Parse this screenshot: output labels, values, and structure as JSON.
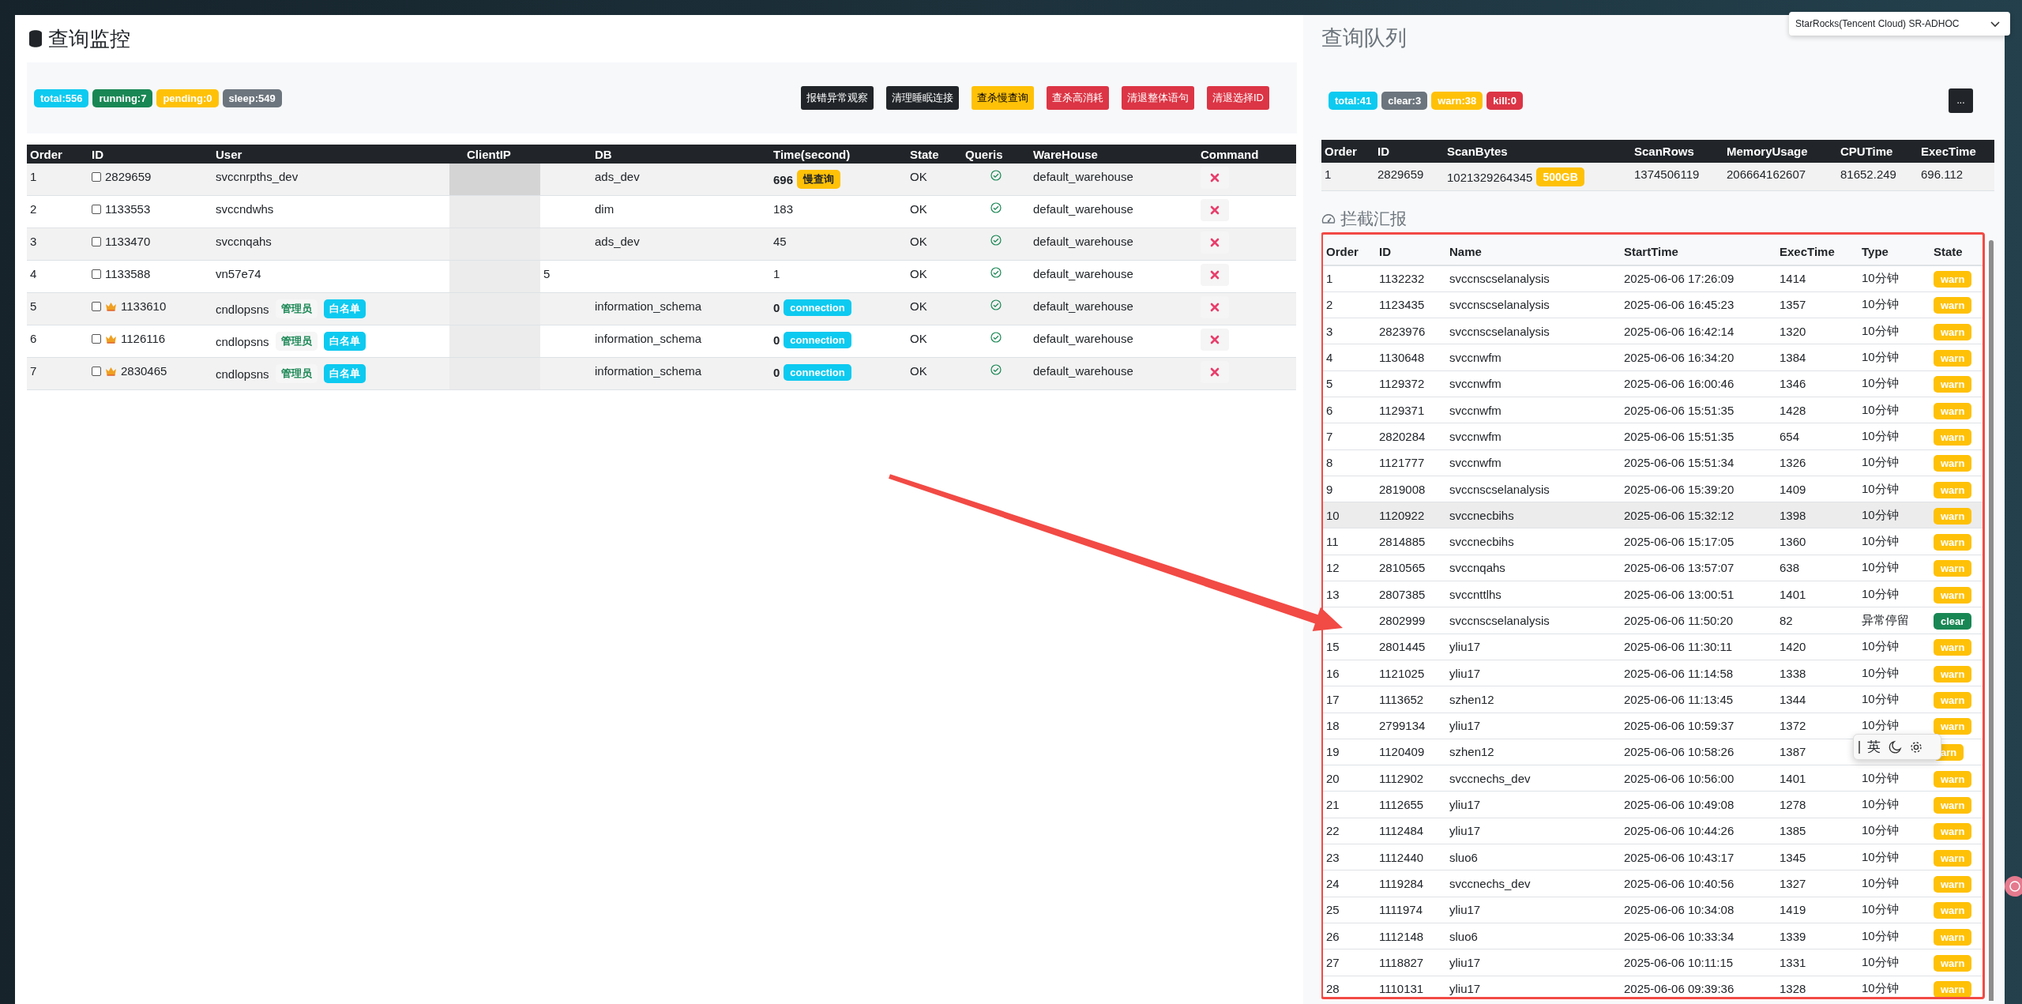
{
  "monitor": {
    "title": "查询监控",
    "badges": [
      {
        "label": "total:556",
        "kind": "info"
      },
      {
        "label": "running:7",
        "kind": "success"
      },
      {
        "label": "pending:0",
        "kind": "warning"
      },
      {
        "label": "sleep:549",
        "kind": "secondary"
      }
    ],
    "buttons": [
      {
        "label": "报错异常观察",
        "kind": "dark"
      },
      {
        "label": "清理睡眠连接",
        "kind": "dark"
      },
      {
        "label": "查杀慢查询",
        "kind": "warning"
      },
      {
        "label": "查杀高消耗",
        "kind": "danger"
      },
      {
        "label": "清退整体语句",
        "kind": "danger"
      },
      {
        "label": "清退选择ID",
        "kind": "danger"
      }
    ],
    "table": {
      "columns": [
        "Order",
        "ID",
        "User",
        "ClientIP",
        "DB",
        "Time(second)",
        "State",
        "Queris",
        "WareHouse",
        "Command"
      ],
      "rows": [
        {
          "order": "1",
          "checked": false,
          "crown": false,
          "id": "2829659",
          "user": "svccnrpths_dev",
          "roles": [],
          "db": "ads_dev",
          "time": "696",
          "time_bold": true,
          "time_tag": {
            "label": "慢查询",
            "kind": "warning"
          },
          "state": "OK",
          "warehouse": "default_warehouse"
        },
        {
          "order": "2",
          "checked": false,
          "crown": false,
          "id": "1133553",
          "user": "svccndwhs",
          "roles": [],
          "db": "dim",
          "time": "183",
          "time_bold": false,
          "state": "OK",
          "warehouse": "default_warehouse"
        },
        {
          "order": "3",
          "checked": false,
          "crown": false,
          "id": "1133470",
          "user": "svccnqahs",
          "roles": [],
          "db": "ads_dev",
          "time": "45",
          "time_bold": false,
          "state": "OK",
          "warehouse": "default_warehouse"
        },
        {
          "order": "4",
          "checked": false,
          "crown": false,
          "id": "1133588",
          "user": "vn57e74",
          "roles": [],
          "client_ip": "5",
          "time": "1",
          "time_bold": false,
          "state": "OK",
          "warehouse": "default_warehouse"
        },
        {
          "order": "5",
          "checked": false,
          "crown": true,
          "id": "1133610",
          "user": "cndlopsns",
          "roles": [
            {
              "label": "管理员",
              "kind": "admin"
            },
            {
              "label": "白名单",
              "kind": "whitelist"
            }
          ],
          "db": "information_schema",
          "time": "0",
          "time_bold": true,
          "time_tag": {
            "label": "connection",
            "kind": "info"
          },
          "state": "OK",
          "warehouse": "default_warehouse"
        },
        {
          "order": "6",
          "checked": false,
          "crown": true,
          "id": "1126116",
          "user": "cndlopsns",
          "roles": [
            {
              "label": "管理员",
              "kind": "admin"
            },
            {
              "label": "白名单",
              "kind": "whitelist"
            }
          ],
          "db": "information_schema",
          "time": "0",
          "time_bold": true,
          "time_tag": {
            "label": "connection",
            "kind": "info"
          },
          "state": "OK",
          "warehouse": "default_warehouse"
        },
        {
          "order": "7",
          "checked": false,
          "crown": true,
          "id": "2830465",
          "user": "cndlopsns",
          "roles": [
            {
              "label": "管理员",
              "kind": "admin"
            },
            {
              "label": "白名单",
              "kind": "whitelist"
            }
          ],
          "db": "information_schema",
          "time": "0",
          "time_bold": true,
          "time_tag": {
            "label": "connection",
            "kind": "info"
          },
          "state": "OK",
          "warehouse": "default_warehouse"
        }
      ]
    }
  },
  "queue": {
    "title": "查询队列",
    "cluster_selector": "StarRocks(Tencent Cloud) SR-ADHOC",
    "badges": [
      {
        "label": "total:41",
        "kind": "info"
      },
      {
        "label": "clear:3",
        "kind": "secondary"
      },
      {
        "label": "warn:38",
        "kind": "warning"
      },
      {
        "label": "kill:0",
        "kind": "danger"
      }
    ],
    "more_button": "...",
    "table": {
      "columns": [
        "Order",
        "ID",
        "ScanBytes",
        "ScanRows",
        "MemoryUsage",
        "CPUTime",
        "ExecTime"
      ],
      "rows": [
        {
          "order": "1",
          "id": "2829659",
          "scan_bytes": "1021329264345",
          "scan_tag": {
            "label": "500GB",
            "kind": "warning"
          },
          "scan_rows": "1374506119",
          "memory": "206664162607",
          "cpu": "81652.249",
          "exec": "696.112"
        }
      ]
    }
  },
  "report": {
    "title": "拦截汇报",
    "columns": [
      "Order",
      "ID",
      "Name",
      "StartTime",
      "ExecTime",
      "Type",
      "State"
    ],
    "rows": [
      {
        "order": "1",
        "id": "1132232",
        "name": "svccnscselanalysis",
        "start": "2025-06-06 17:26:09",
        "exec": "1414",
        "type": "10分钟",
        "state": {
          "label": "warn",
          "kind": "warning"
        },
        "highlighted": false
      },
      {
        "order": "2",
        "id": "1123435",
        "name": "svccnscselanalysis",
        "start": "2025-06-06 16:45:23",
        "exec": "1357",
        "type": "10分钟",
        "state": {
          "label": "warn",
          "kind": "warning"
        },
        "highlighted": false
      },
      {
        "order": "3",
        "id": "2823976",
        "name": "svccnscselanalysis",
        "start": "2025-06-06 16:42:14",
        "exec": "1320",
        "type": "10分钟",
        "state": {
          "label": "warn",
          "kind": "warning"
        },
        "highlighted": false
      },
      {
        "order": "4",
        "id": "1130648",
        "name": "svccnwfm",
        "start": "2025-06-06 16:34:20",
        "exec": "1384",
        "type": "10分钟",
        "state": {
          "label": "warn",
          "kind": "warning"
        },
        "highlighted": false
      },
      {
        "order": "5",
        "id": "1129372",
        "name": "svccnwfm",
        "start": "2025-06-06 16:00:46",
        "exec": "1346",
        "type": "10分钟",
        "state": {
          "label": "warn",
          "kind": "warning"
        },
        "highlighted": false
      },
      {
        "order": "6",
        "id": "1129371",
        "name": "svccnwfm",
        "start": "2025-06-06 15:51:35",
        "exec": "1428",
        "type": "10分钟",
        "state": {
          "label": "warn",
          "kind": "warning"
        },
        "highlighted": false
      },
      {
        "order": "7",
        "id": "2820284",
        "name": "svccnwfm",
        "start": "2025-06-06 15:51:35",
        "exec": "654",
        "type": "10分钟",
        "state": {
          "label": "warn",
          "kind": "warning"
        },
        "highlighted": false
      },
      {
        "order": "8",
        "id": "1121777",
        "name": "svccnwfm",
        "start": "2025-06-06 15:51:34",
        "exec": "1326",
        "type": "10分钟",
        "state": {
          "label": "warn",
          "kind": "warning"
        },
        "highlighted": false
      },
      {
        "order": "9",
        "id": "2819008",
        "name": "svccnscselanalysis",
        "start": "2025-06-06 15:39:20",
        "exec": "1409",
        "type": "10分钟",
        "state": {
          "label": "warn",
          "kind": "warning"
        },
        "highlighted": false
      },
      {
        "order": "10",
        "id": "1120922",
        "name": "svccnecbihs",
        "start": "2025-06-06 15:32:12",
        "exec": "1398",
        "type": "10分钟",
        "state": {
          "label": "warn",
          "kind": "warning"
        },
        "highlighted": true
      },
      {
        "order": "11",
        "id": "2814885",
        "name": "svccnecbihs",
        "start": "2025-06-06 15:17:05",
        "exec": "1360",
        "type": "10分钟",
        "state": {
          "label": "warn",
          "kind": "warning"
        },
        "highlighted": false
      },
      {
        "order": "12",
        "id": "2810565",
        "name": "svccnqahs",
        "start": "2025-06-06 13:57:07",
        "exec": "638",
        "type": "10分钟",
        "state": {
          "label": "warn",
          "kind": "warning"
        },
        "highlighted": false
      },
      {
        "order": "13",
        "id": "2807385",
        "name": "svccnttlhs",
        "start": "2025-06-06 13:00:51",
        "exec": "1401",
        "type": "10分钟",
        "state": {
          "label": "warn",
          "kind": "warning"
        },
        "highlighted": false
      },
      {
        "id": "2802999",
        "name": "svccnscselanalysis",
        "start": "2025-06-06 11:50:20",
        "exec": "82",
        "type": "异常停留",
        "state": {
          "label": "clear",
          "kind": "success"
        },
        "highlighted": false
      },
      {
        "order": "15",
        "id": "2801445",
        "name": "yliu17",
        "start": "2025-06-06 11:30:11",
        "exec": "1420",
        "type": "10分钟",
        "state": {
          "label": "warn",
          "kind": "warning"
        },
        "highlighted": false
      },
      {
        "order": "16",
        "id": "1121025",
        "name": "yliu17",
        "start": "2025-06-06 11:14:58",
        "exec": "1338",
        "type": "10分钟",
        "state": {
          "label": "warn",
          "kind": "warning"
        },
        "highlighted": false
      },
      {
        "order": "17",
        "id": "1113652",
        "name": "szhen12",
        "start": "2025-06-06 11:13:45",
        "exec": "1344",
        "type": "10分钟",
        "state": {
          "label": "warn",
          "kind": "warning"
        },
        "highlighted": false
      },
      {
        "order": "18",
        "id": "2799134",
        "name": "yliu17",
        "start": "2025-06-06 10:59:37",
        "exec": "1372",
        "type": "10分钟",
        "state": {
          "label": "warn",
          "kind": "warning"
        },
        "highlighted": false
      },
      {
        "order": "19",
        "id": "1120409",
        "name": "szhen12",
        "start": "2025-06-06 10:58:26",
        "exec": "1387",
        "state": {
          "label": "arn",
          "kind": "warning"
        },
        "highlighted": false
      },
      {
        "order": "20",
        "id": "1112902",
        "name": "svccnechs_dev",
        "start": "2025-06-06 10:56:00",
        "exec": "1401",
        "type": "10分钟",
        "state": {
          "label": "warn",
          "kind": "warning"
        },
        "highlighted": false
      },
      {
        "order": "21",
        "id": "1112655",
        "name": "yliu17",
        "start": "2025-06-06 10:49:08",
        "exec": "1278",
        "type": "10分钟",
        "state": {
          "label": "warn",
          "kind": "warning"
        },
        "highlighted": false
      },
      {
        "order": "22",
        "id": "1112484",
        "name": "yliu17",
        "start": "2025-06-06 10:44:26",
        "exec": "1385",
        "type": "10分钟",
        "state": {
          "label": "warn",
          "kind": "warning"
        },
        "highlighted": false
      },
      {
        "order": "23",
        "id": "1112440",
        "name": "sluo6",
        "start": "2025-06-06 10:43:17",
        "exec": "1345",
        "type": "10分钟",
        "state": {
          "label": "warn",
          "kind": "warning"
        },
        "highlighted": false
      },
      {
        "order": "24",
        "id": "1119284",
        "name": "svccnechs_dev",
        "start": "2025-06-06 10:40:56",
        "exec": "1327",
        "type": "10分钟",
        "state": {
          "label": "warn",
          "kind": "warning"
        },
        "highlighted": false
      },
      {
        "order": "25",
        "id": "1111974",
        "name": "yliu17",
        "start": "2025-06-06 10:34:08",
        "exec": "1419",
        "type": "10分钟",
        "state": {
          "label": "warn",
          "kind": "warning"
        },
        "highlighted": false
      },
      {
        "order": "26",
        "id": "1112148",
        "name": "sluo6",
        "start": "2025-06-06 10:33:34",
        "exec": "1339",
        "type": "10分钟",
        "state": {
          "label": "warn",
          "kind": "warning"
        },
        "highlighted": false
      },
      {
        "order": "27",
        "id": "1118827",
        "name": "yliu17",
        "start": "2025-06-06 10:11:15",
        "exec": "1331",
        "type": "10分钟",
        "state": {
          "label": "warn",
          "kind": "warning"
        },
        "highlighted": false
      },
      {
        "order": "28",
        "id": "1110131",
        "name": "yliu17",
        "start": "2025-06-06 09:39:36",
        "exec": "1328",
        "type": "10分钟",
        "state": {
          "label": "warn",
          "kind": "warning"
        },
        "highlighted": false
      }
    ]
  },
  "ime_toolbar": {
    "mode": "英"
  }
}
